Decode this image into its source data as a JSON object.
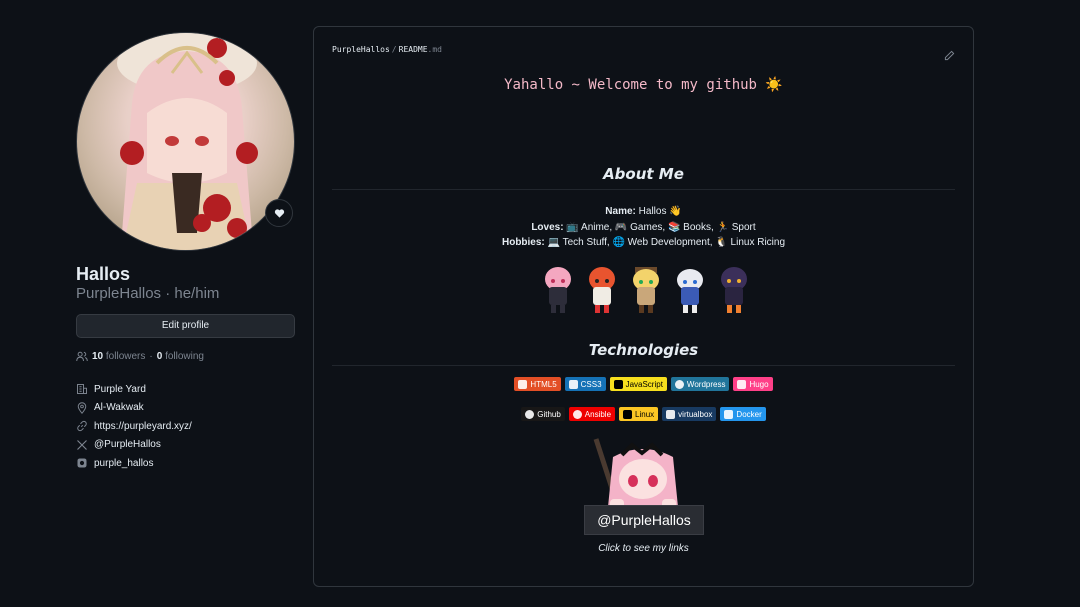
{
  "profile": {
    "name": "Hallos",
    "username_pronouns": "PurpleHallos · he/him",
    "edit_button": "Edit profile",
    "followers_count": "10",
    "followers_label": "followers",
    "separator": "·",
    "following_count": "0",
    "following_label": "following",
    "details": [
      {
        "icon": "organization-icon",
        "text": "Purple Yard"
      },
      {
        "icon": "location-icon",
        "text": "Al-Wakwak"
      },
      {
        "icon": "link-icon",
        "text": "https://purpleyard.xyz/"
      },
      {
        "icon": "x-twitter-icon",
        "text": "@PurpleHallos"
      },
      {
        "icon": "instagram-icon",
        "text": "purple_hallos"
      }
    ]
  },
  "readme": {
    "breadcrumb_user": "PurpleHallos",
    "breadcrumb_sep": "/",
    "breadcrumb_file": "README",
    "breadcrumb_ext": ".md",
    "welcome": "Yahallo ~ Welcome to my github ☀️",
    "about_heading": "About Me",
    "name_label": "Name:",
    "name_value": "Hallos 👋",
    "loves_label": "Loves:",
    "loves_value": "📺 Anime, 🎮 Games, 📚 Books, 🏃 Sport",
    "hobbies_label": "Hobbies:",
    "hobbies_value": "💻 Tech Stuff, 🌐 Web Development, 🐧 Linux Ricing",
    "tech_heading": "Technologies",
    "badges_row1": [
      {
        "label": "HTML5",
        "color": "#e34f26"
      },
      {
        "label": "CSS3",
        "color": "#1572b6"
      },
      {
        "label": "JavaScript",
        "color": "#f7df1e",
        "text_color": "#000000"
      },
      {
        "label": "Wordpress",
        "color": "#21759b"
      },
      {
        "label": "Hugo",
        "color": "#ff4088"
      }
    ],
    "badges_row2": [
      {
        "label": "Github",
        "color": "#181717"
      },
      {
        "label": "Ansible",
        "color": "#ee0000"
      },
      {
        "label": "Linux",
        "color": "#fcc624",
        "text_color": "#000000"
      },
      {
        "label": "virtualbox",
        "color": "#183a61"
      },
      {
        "label": "Docker",
        "color": "#2496ed"
      }
    ],
    "handle": "@PurpleHallos",
    "see_links": "Click to see my links"
  },
  "colors": {
    "background": "#0d1117",
    "border": "#30363d",
    "muted": "#7d8590",
    "welcome_pink": "#f4b9c8"
  }
}
